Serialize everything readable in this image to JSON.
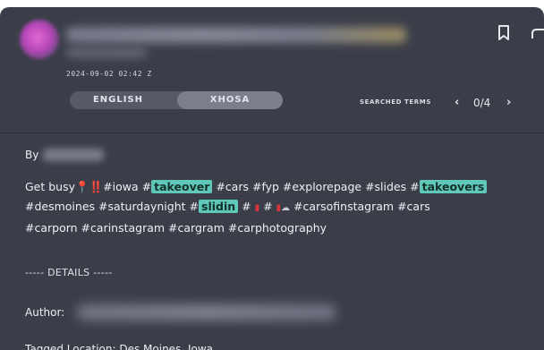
{
  "header": {
    "timestamp": "2024-09-02 02:42 Z"
  },
  "language_toggle": {
    "options": [
      "ENGLISH",
      "XHOSA"
    ],
    "selected": "XHOSA"
  },
  "search_nav": {
    "label": "SEARCHED TERMS",
    "prev": "‹",
    "count": "0/4",
    "next": "›"
  },
  "post": {
    "by_label": "By",
    "segments": {
      "s1": "Get busy",
      "s2": "‼️#iowa #",
      "h1": "takeover",
      "s3": " #cars #fyp #explorepage #slides #",
      "h2": "takeovers",
      "s4": "#desmoines #saturdaynight #",
      "h3": "slidin",
      "s5": " # ",
      "s6": " # ",
      "s7": " #carsofinstagram #cars",
      "line3": "#carporn #carinstagram #cargram #carphotography"
    }
  },
  "details": {
    "title": "----- DETAILS -----",
    "author_label": "Author:",
    "tagged_location": "Tagged Location: Des Moines, Iowa"
  }
}
